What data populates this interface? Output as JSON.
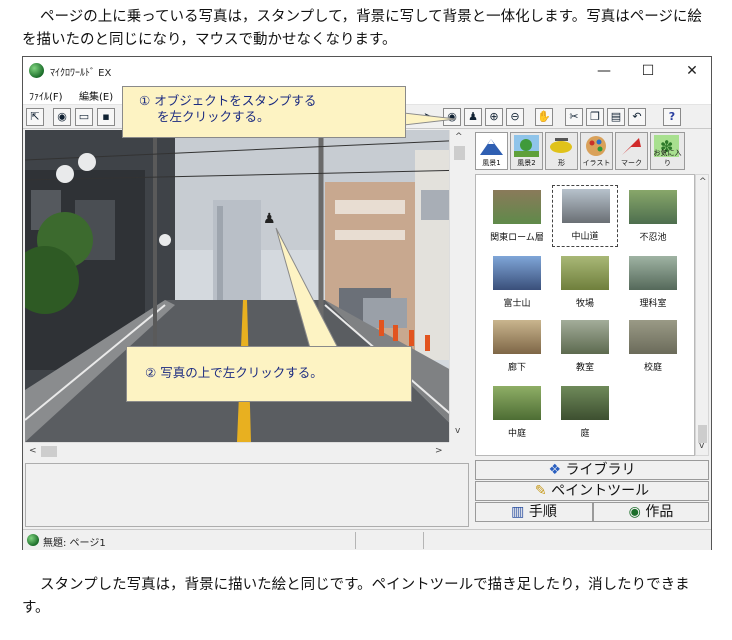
{
  "intro_text": "ページの上に乗っている写真は，スタンプして，背景に写して背景と一体化します。写真はページに絵を描いたのと同じになり，マウスで動かせなくなります。",
  "outro_text": "スタンプした写真は，背景に描いた絵と同じです。ペイントツールで描き足したり，消したりできます。",
  "window": {
    "title": "ﾏｲｸﾛﾜｰﾙﾄﾞ EX",
    "controls": {
      "minimize": "—",
      "maximize": "☐",
      "close": "✕"
    }
  },
  "menu": [
    {
      "label": "ﾌｧｲﾙ(F)"
    },
    {
      "label": "編集(E)"
    }
  ],
  "toolbar": {
    "left": [
      {
        "icon": "pointer-icon",
        "glyph": "⇱"
      },
      {
        "icon": "globe-icon",
        "glyph": "◉"
      },
      {
        "icon": "open-folder-icon",
        "glyph": "▭"
      },
      {
        "icon": "save-icon",
        "glyph": "▪"
      }
    ],
    "right": [
      {
        "icon": "cursor-arrow-icon",
        "glyph": "➤"
      },
      {
        "icon": "eye-icon",
        "glyph": "◉"
      },
      {
        "icon": "stamp-icon",
        "glyph": "♟"
      },
      {
        "icon": "zoom-in-icon",
        "glyph": "⊕"
      },
      {
        "icon": "zoom-out-icon",
        "glyph": "⊖"
      },
      {
        "icon": "stop-icon",
        "glyph": "✋"
      },
      {
        "icon": "cut-icon",
        "glyph": "✂"
      },
      {
        "icon": "copy-icon",
        "glyph": "❐"
      },
      {
        "icon": "paste-icon",
        "glyph": "▤"
      },
      {
        "icon": "undo-icon",
        "glyph": "↶"
      },
      {
        "icon": "help-icon",
        "glyph": "?"
      }
    ]
  },
  "callout1": {
    "number": "①",
    "line1": "オブジェクトをスタンプする",
    "line2": "を左クリックする。"
  },
  "callout2": {
    "number": "②",
    "text": "写真の上で左クリックする。"
  },
  "categories": [
    {
      "label": "風景1",
      "icon": "mountain-icon",
      "active": true
    },
    {
      "label": "風景2",
      "icon": "landscape-icon",
      "active": false
    },
    {
      "label": "形",
      "icon": "shape-icon",
      "active": false
    },
    {
      "label": "イラスト",
      "icon": "illustration-icon",
      "active": false
    },
    {
      "label": "マーク",
      "icon": "mark-icon",
      "active": false
    },
    {
      "label": "お気に入り",
      "icon": "favorite-icon",
      "active": false
    }
  ],
  "thumbnails": [
    {
      "label": "関東ローム層",
      "selected": false,
      "colors": [
        "#8a7a5a",
        "#5f8a4a"
      ]
    },
    {
      "label": "中山道",
      "selected": true,
      "colors": [
        "#b7c2cc",
        "#6a6f74"
      ]
    },
    {
      "label": "不忍池",
      "selected": false,
      "colors": [
        "#88a76a",
        "#4d6e4e"
      ]
    },
    {
      "label": "富士山",
      "selected": false,
      "colors": [
        "#7fa6d8",
        "#3a4f7a"
      ]
    },
    {
      "label": "牧場",
      "selected": false,
      "colors": [
        "#a9b877",
        "#6f7f3c"
      ]
    },
    {
      "label": "理科室",
      "selected": false,
      "colors": [
        "#9fb3a3",
        "#55695a"
      ]
    },
    {
      "label": "廊下",
      "selected": false,
      "colors": [
        "#c9b58e",
        "#7e6646"
      ]
    },
    {
      "label": "教室",
      "selected": false,
      "colors": [
        "#a3ad9a",
        "#5d6a4f"
      ]
    },
    {
      "label": "校庭",
      "selected": false,
      "colors": [
        "#9a9a86",
        "#6b6b5a"
      ]
    },
    {
      "label": "中庭",
      "selected": false,
      "colors": [
        "#8fae66",
        "#4d6d34"
      ]
    },
    {
      "label": "庭",
      "selected": false,
      "colors": [
        "#6f8a5a",
        "#3d4f30"
      ]
    }
  ],
  "side_buttons": {
    "library": "ライブラリ",
    "paint_tool": "ペイントツール",
    "procedure": "手順",
    "works": "作品"
  },
  "status": {
    "text": "無題: ページ1"
  }
}
